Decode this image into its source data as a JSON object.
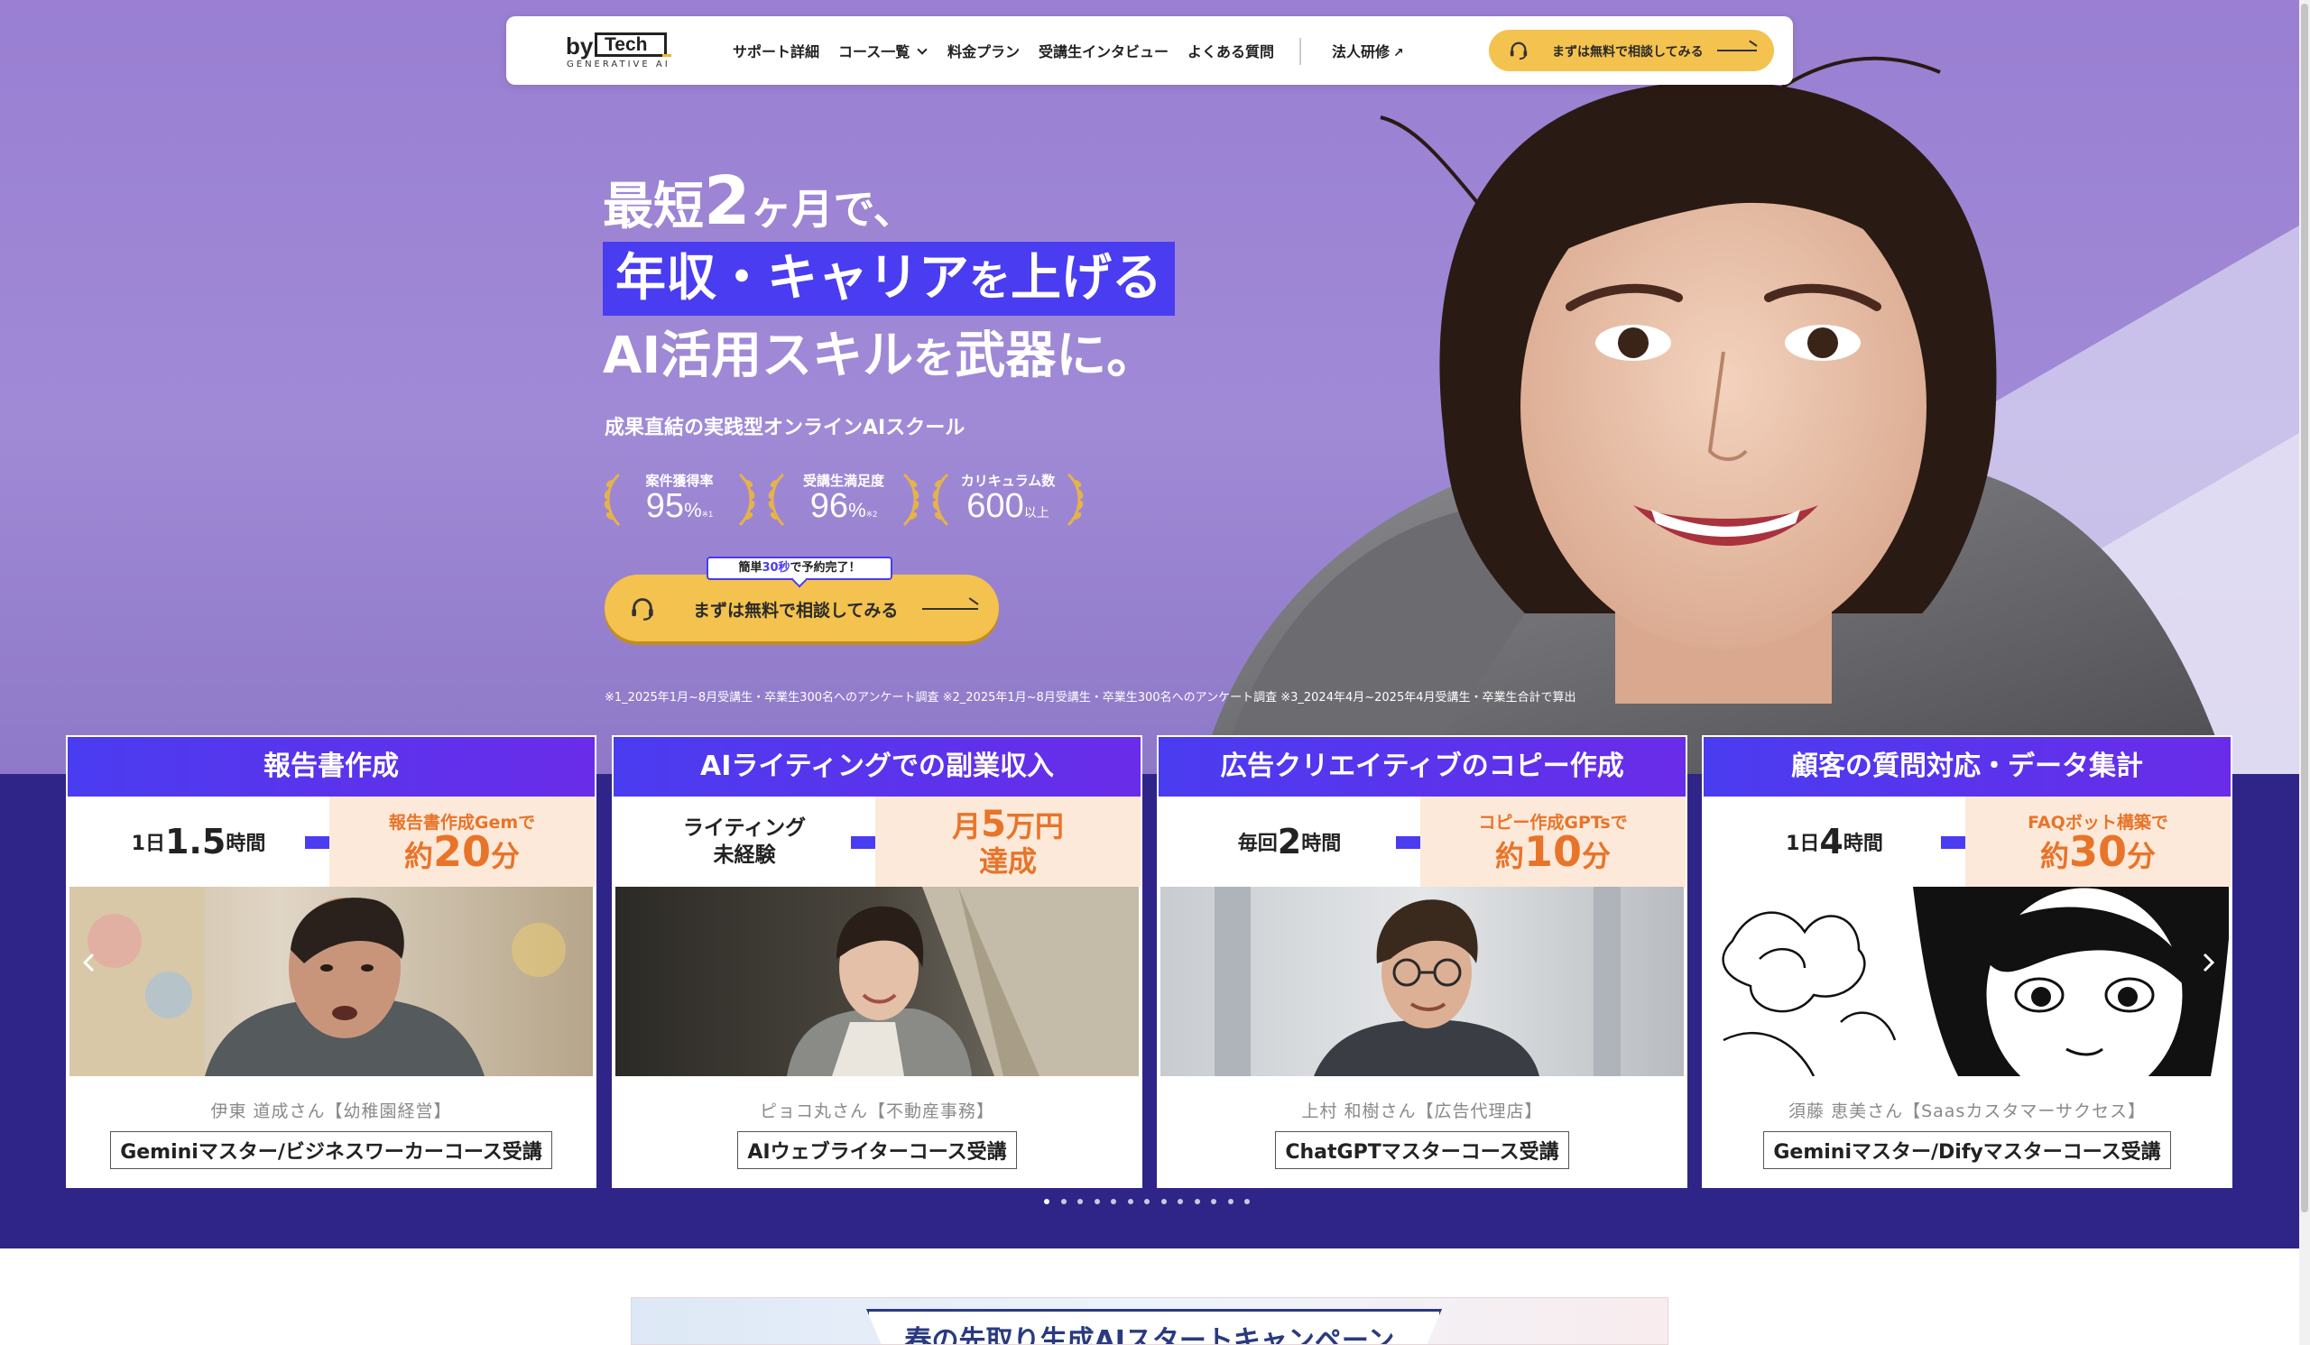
{
  "nav": {
    "logo_by": "by",
    "logo_tech": "Tech",
    "logo_sub": "GENERATIVE AI",
    "items": [
      "サポート詳細",
      "コース一覧",
      "料金プラン",
      "受講生インタビュー",
      "よくある質問"
    ],
    "corporate": "法人研修",
    "cta": "まずは無料で相談してみる"
  },
  "hero": {
    "line1_a": "最短",
    "line1_num": "2",
    "line1_b": "ヶ月で、",
    "line2_a": "年収・キャリア",
    "line2_small": "を",
    "line2_b": "上げる",
    "line3_a": "AI活用スキル",
    "line3_small": "を",
    "line3_b": "武器に。",
    "subtitle": "成果直結の実践型オンラインAIスクール",
    "stats": [
      {
        "title": "案件獲得率",
        "value": "95",
        "unit": "%",
        "note": "※1"
      },
      {
        "title": "受講生満足度",
        "value": "96",
        "unit": "%",
        "note": "※2"
      },
      {
        "title": "カリキュラム数",
        "value": "600",
        "unit": "以上",
        "note": ""
      }
    ],
    "tooltip_a": "簡単",
    "tooltip_em": "30秒",
    "tooltip_b": "で予約完了！",
    "cta": "まずは無料で相談してみる",
    "footnote": "※1_2025年1月~8月受講生・卒業生300名へのアンケート調査 ※2_2025年1月~8月受講生・卒業生300名へのアンケート調査 ※3_2024年4月~2025年4月受講生・卒業生合計で算出"
  },
  "cards": [
    {
      "title": "報告書作成",
      "before_a": "1日",
      "before_num": "1.5",
      "before_b": "時間",
      "after_small": "報告書作成Gemで",
      "after_a": "約",
      "after_num": "20",
      "after_b": "分",
      "name": "伊東 道成さん【幼稚園経営】",
      "course": "Geminiマスター/ビジネスワーカーコース受講"
    },
    {
      "title": "AIライティングでの副業収入",
      "before_text": "ライティング\n未経験",
      "after_l1_a": "月",
      "after_l1_num": "5",
      "after_l1_b": "万円",
      "after_l2": "達成",
      "name": "ピョコ丸さん【不動産事務】",
      "course": "AIウェブライターコース受講"
    },
    {
      "title": "広告クリエイティブのコピー作成",
      "before_a": "毎回",
      "before_num": "2",
      "before_b": "時間",
      "after_small": "コピー作成GPTsで",
      "after_a": "約",
      "after_num": "10",
      "after_b": "分",
      "name": "上村 和樹さん【広告代理店】",
      "course": "ChatGPTマスターコース受講"
    },
    {
      "title": "顧客の質問対応・データ集計",
      "before_a": "1日",
      "before_num": "4",
      "before_b": "時間",
      "after_small": "FAQボット構築で",
      "after_a": "約",
      "after_num": "30",
      "after_b": "分",
      "name": "須藤 恵美さん【Saasカスタマーサクセス】",
      "course": "Geminiマスター/Difyマスターコース受講"
    }
  ],
  "carousel": {
    "dot_count": 13,
    "active_index": 0
  },
  "banner": {
    "text": "春の先取り生成AIスタートキャンペーン"
  },
  "colors": {
    "accent": "#4a3cf0",
    "cta": "#f4c24e",
    "strip": "#2f2488",
    "hero": "#9a7fd2",
    "orange": "#e8742a"
  },
  "icons": [
    "headset-icon",
    "external-link-icon",
    "chevron-down-icon",
    "arrow-right-icon",
    "laurel-icon",
    "chevron-left-icon",
    "chevron-right-icon"
  ]
}
